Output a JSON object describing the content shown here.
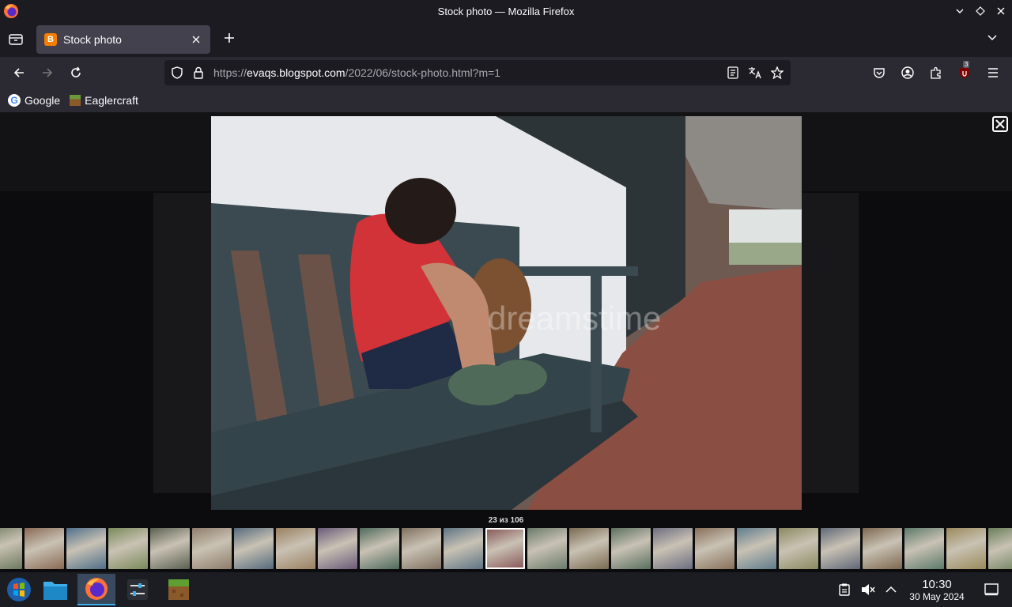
{
  "window": {
    "title": "Stock photo — Mozilla Firefox"
  },
  "tabs": [
    {
      "label": "Stock photo",
      "favicon": "blogger-icon"
    }
  ],
  "urlbar": {
    "url_prefix": "https://",
    "url_domain": "evaqs.blogspot.com",
    "url_path": "/2022/06/stock-photo.html?m=1"
  },
  "extensions": {
    "badge_count": "3"
  },
  "bookmarks": [
    {
      "label": "Google",
      "icon": "google-icon"
    },
    {
      "label": "Eaglercraft",
      "icon": "grass-block-icon"
    }
  ],
  "viewer": {
    "counter": "23 из 106",
    "watermark": "dreamstime",
    "thumbnail_count": 25,
    "active_thumbnail": 12
  },
  "taskbar": {
    "time": "10:30",
    "date": "30 May 2024",
    "apps": [
      "start-menu",
      "file-manager",
      "firefox",
      "settings",
      "minecraft"
    ]
  },
  "colors": {
    "accent": "#3daee9",
    "chrome_dark": "#1c1b22",
    "toolbar": "#2b2a33"
  }
}
